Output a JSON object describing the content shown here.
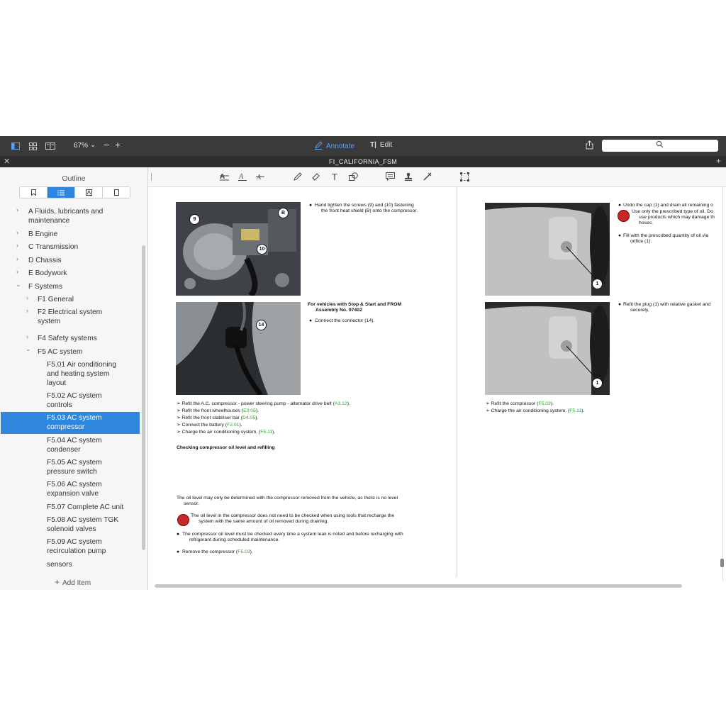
{
  "toolbar": {
    "zoom": "67%",
    "annotate_label": "Annotate",
    "edit_label": "Edit"
  },
  "document": {
    "title": "FI_CALIFORNIA_FSM"
  },
  "sidebar": {
    "title": "Outline",
    "add_item": "Add Item",
    "items": [
      {
        "label": "A   Fluids, lubricants and"
      },
      {
        "label": "maintenance"
      },
      {
        "label": "B   Engine"
      },
      {
        "label": "C   Transmission"
      },
      {
        "label": "D   Chassis"
      },
      {
        "label": "E   Bodywork"
      },
      {
        "label": "F   Systems"
      },
      {
        "label": "F1   General"
      },
      {
        "label": "F2   Electrical system"
      },
      {
        "label": "system"
      },
      {
        "label": "F4   Safety systems"
      },
      {
        "label": "F5   AC system"
      },
      {
        "label": "F5.01 Air conditioning"
      },
      {
        "label": "and heating system"
      },
      {
        "label": "layout"
      },
      {
        "label": "F5.02 AC system"
      },
      {
        "label": "controls"
      },
      {
        "label": "F5.03 AC system"
      },
      {
        "label": "compressor"
      },
      {
        "label": "F5.04 AC system"
      },
      {
        "label": "condenser"
      },
      {
        "label": "F5.05 AC system"
      },
      {
        "label": "pressure switch"
      },
      {
        "label": "F5.06 AC system"
      },
      {
        "label": "expansion valve"
      },
      {
        "label": "F5.07 Complete AC unit"
      },
      {
        "label": "F5.08 AC system TGK"
      },
      {
        "label": "solenoid valves"
      },
      {
        "label": "F5.09 AC system"
      },
      {
        "label": "recirculation pump"
      },
      {
        "label": "sensors"
      }
    ]
  },
  "left_page": {
    "p1_bullet": "Hand tighten the screws (9) and (10) fastening",
    "p1_bullet2": "the front heat shield (B) onto the compressor.",
    "p2_head1": "For vehicles with Stop & Start and FROM",
    "p2_head2": "Assembly No. 97402",
    "p2_bullet": "Connect the connector (14).",
    "callouts": [
      "9",
      "B",
      "10",
      "14"
    ],
    "steps": [
      {
        "text": "➢ Refit the A.C. compressor - power steering pump - alternator drive belt (",
        "ref": "A3.12",
        "end": ")."
      },
      {
        "text": "➢ Refit the front wheelhouses (",
        "ref": "E3.05",
        "end": ")."
      },
      {
        "text": "➢ Refit the front stabiliser bar (",
        "ref": "D4.05",
        "end": ")."
      },
      {
        "text": "➢ Connect the battery (",
        "ref": "F2.01",
        "end": ")."
      },
      {
        "text": "➢ Charge the air conditioning system. (",
        "ref": "F5.11",
        "end": ")."
      }
    ],
    "section_title": "Checking compressor oil level and refilling",
    "oil_note1": "The oil level may only be determined with the compressor removed from the vehicle, as there is no level",
    "oil_note2": "sensor.",
    "warn1": "The oil level in the compressor does not need to be checked when using tools that recharge the",
    "warn2": "system with the same amount of oil removed during draining.",
    "bullet_leak1": "The compressor oil level must be checked every time a system leak is noted and before recharging with",
    "bullet_leak2": "refrigerant during scheduled maintenance.",
    "remove_text": "Remove the compressor (",
    "remove_ref": "F5.03",
    "remove_end": ")."
  },
  "right_page": {
    "b1_1": "Undo the cap (1) and drain all remaining o",
    "b1_2": "Use only the prescribed type of oil. Do",
    "b1_3": "use products which may damage th",
    "b1_4": "hoses.",
    "b2_1": "Fill with the prescribed quantity of oil via",
    "b2_2": "orifice (1).",
    "b3_1": "Refit the plug (1) with relative gasket and",
    "b3_2": "securely.",
    "callout": "1",
    "steps": [
      {
        "text": "➢ Refit the compressor (",
        "ref": "F5.03",
        "end": ")."
      },
      {
        "text": "➢ Charge the air conditioning system. (",
        "ref": "F5.11",
        "end": ")."
      }
    ]
  }
}
